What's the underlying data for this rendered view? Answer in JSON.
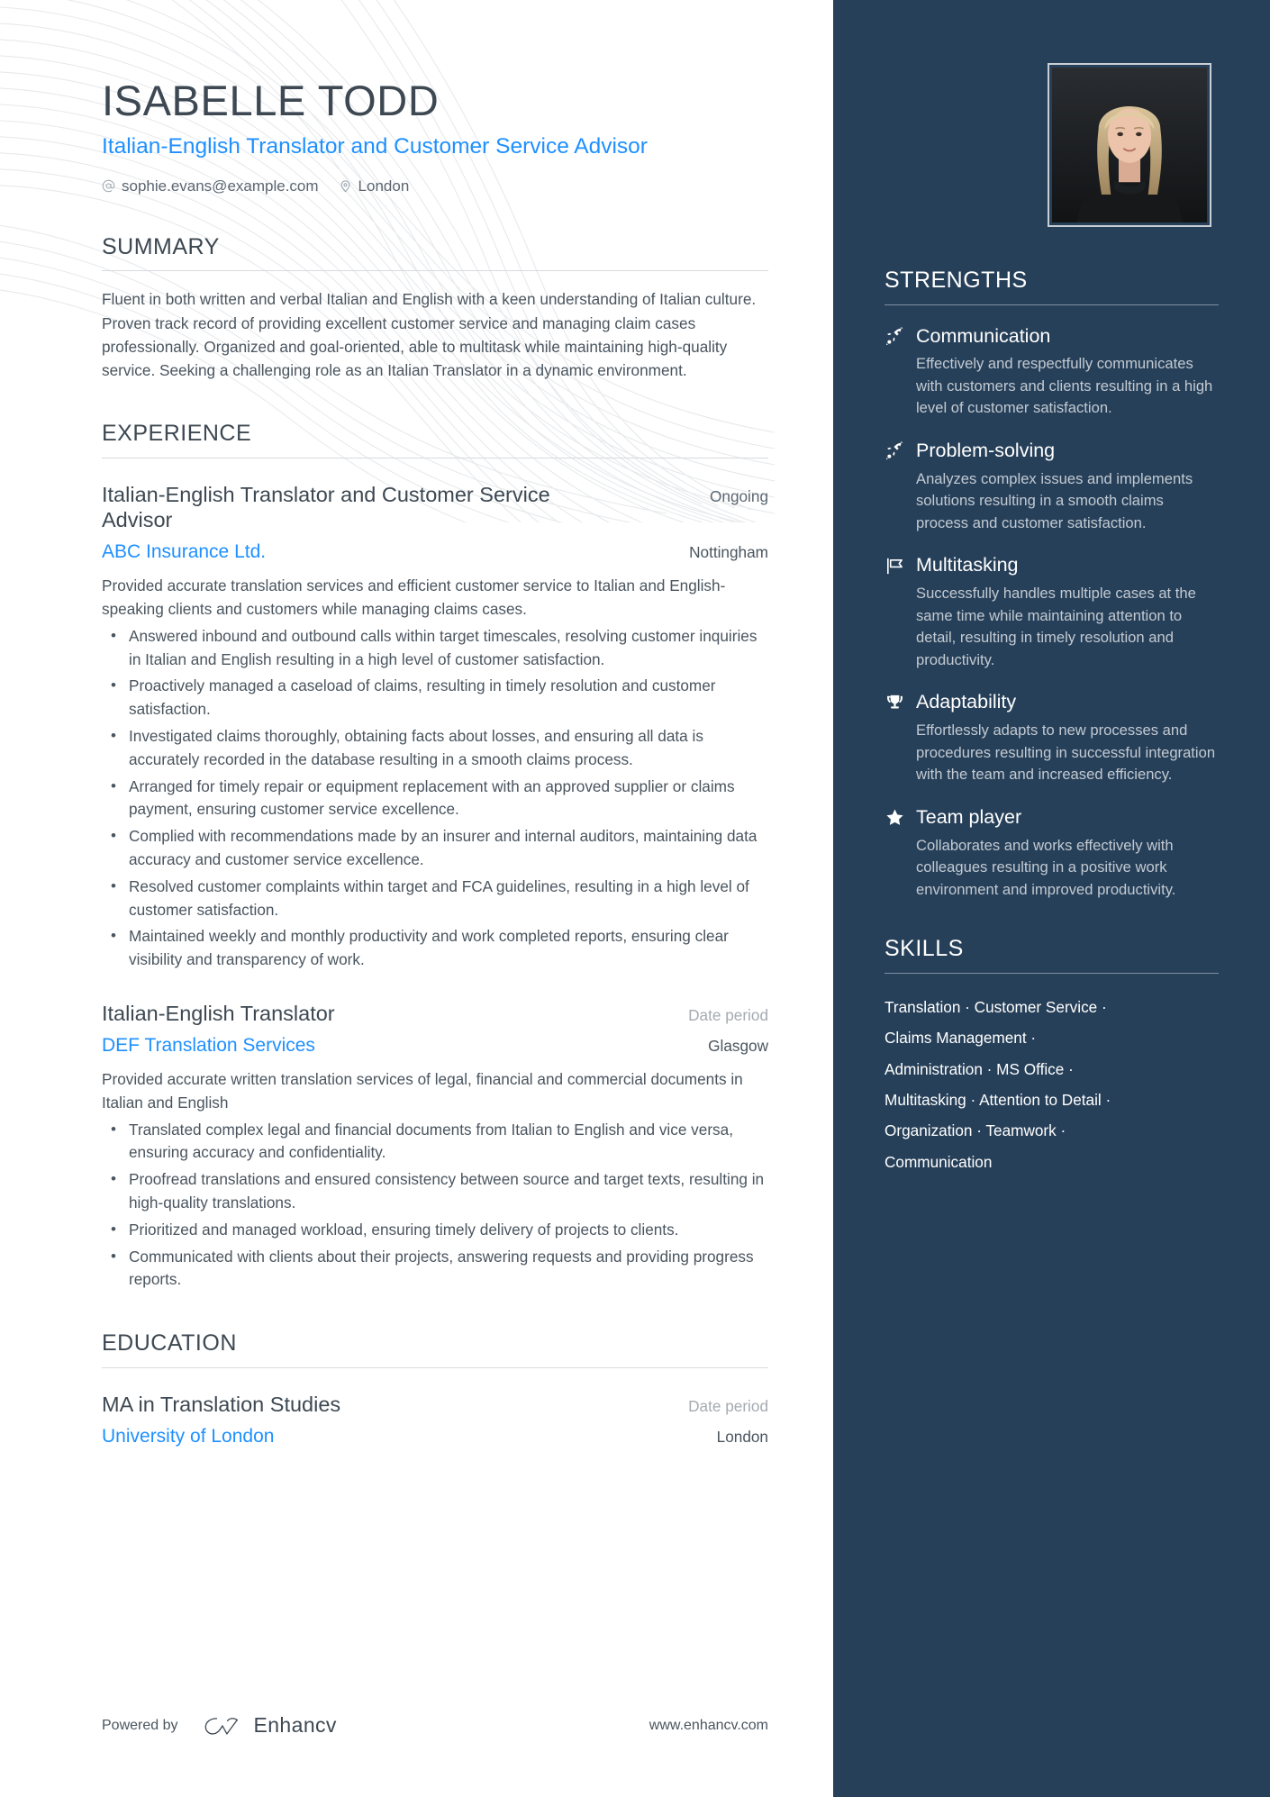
{
  "header": {
    "name": "ISABELLE TODD",
    "job_title": "Italian-English Translator and Customer Service Advisor",
    "contacts": [
      {
        "icon": "at-sign-icon",
        "value": "sophie.evans@example.com"
      },
      {
        "icon": "map-pin-icon",
        "value": "London"
      }
    ]
  },
  "colors": {
    "accent_blue": "#1e90ff",
    "sidebar_navy": "#274059",
    "heading_gray": "#3d4852",
    "body_gray": "#4a555f",
    "muted_gray": "#a4abb2"
  },
  "summary": {
    "title": "SUMMARY",
    "text": "Fluent in both written and verbal Italian and English with a keen understanding of Italian culture. Proven track record of providing excellent customer service and managing claim cases professionally. Organized and goal-oriented, able to multitask while maintaining high-quality service. Seeking a challenging role as an Italian Translator in a dynamic environment."
  },
  "experience": {
    "title": "EXPERIENCE",
    "entries": [
      {
        "role": "Italian-English Translator and Customer Service Advisor",
        "date": "Ongoing",
        "date_muted": false,
        "organization": "ABC Insurance Ltd.",
        "location": "Nottingham",
        "description": "Provided accurate translation services and efficient customer service to Italian and English-speaking clients and customers while managing claims cases.",
        "bullets": [
          "Answered inbound and outbound calls within target timescales, resolving customer inquiries in Italian and English resulting in a high level of customer satisfaction.",
          "Proactively managed a caseload of claims, resulting in timely resolution and customer satisfaction.",
          "Investigated claims thoroughly, obtaining facts about losses, and ensuring all data is accurately recorded in the database resulting in a smooth claims process.",
          "Arranged for timely repair or equipment replacement with an approved supplier or claims payment, ensuring customer service excellence.",
          "Complied with recommendations made by an insurer and internal auditors, maintaining data accuracy and customer service excellence.",
          "Resolved customer complaints within target and FCA guidelines, resulting in a high level of customer satisfaction.",
          "Maintained weekly and monthly productivity and work completed reports, ensuring clear visibility and transparency of work."
        ]
      },
      {
        "role": "Italian-English Translator",
        "date": "Date period",
        "date_muted": true,
        "organization": "DEF Translation Services",
        "location": "Glasgow",
        "description": "Provided accurate written translation services of legal, financial and commercial documents in Italian and English",
        "bullets": [
          "Translated complex legal and financial documents from Italian to English and vice versa, ensuring accuracy and confidentiality.",
          "Proofread translations and ensured consistency between source and target texts, resulting in high-quality translations.",
          "Prioritized and managed workload, ensuring timely delivery of projects to clients.",
          "Communicated with clients about their projects, answering requests and providing progress reports."
        ]
      }
    ]
  },
  "education": {
    "title": "EDUCATION",
    "entries": [
      {
        "degree": "MA in Translation Studies",
        "date": "Date period",
        "date_muted": true,
        "institution": "University of London",
        "location": "London"
      }
    ]
  },
  "footer": {
    "powered_by": "Powered by",
    "brand": "Enhancv",
    "url": "www.enhancv.com"
  },
  "sidebar": {
    "strengths": {
      "title": "STRENGTHS",
      "items": [
        {
          "icon": "rocket-icon",
          "name": "Communication",
          "description": "Effectively and respectfully communicates with customers and clients resulting in a high level of customer satisfaction."
        },
        {
          "icon": "rocket-icon",
          "name": "Problem-solving",
          "description": "Analyzes complex issues and implements solutions resulting in a smooth claims process and customer satisfaction."
        },
        {
          "icon": "flag-icon",
          "name": "Multitasking",
          "description": "Successfully handles multiple cases at the same time while maintaining attention to detail, resulting in timely resolution and productivity."
        },
        {
          "icon": "trophy-icon",
          "name": "Adaptability",
          "description": "Effortlessly adapts to new processes and procedures resulting in successful integration with the team and increased efficiency."
        },
        {
          "icon": "star-icon",
          "name": "Team player",
          "description": "Collaborates and works effectively with colleagues resulting in a positive work environment and improved productivity."
        }
      ]
    },
    "skills": {
      "title": "SKILLS",
      "separator": "·",
      "lines": [
        "Translation · Customer Service ·",
        "Claims Management ·",
        "Administration · MS Office ·",
        "Multitasking · Attention to Detail ·",
        "Organization · Teamwork ·",
        "Communication"
      ]
    },
    "photo": {
      "alt": "portrait-photo"
    }
  }
}
